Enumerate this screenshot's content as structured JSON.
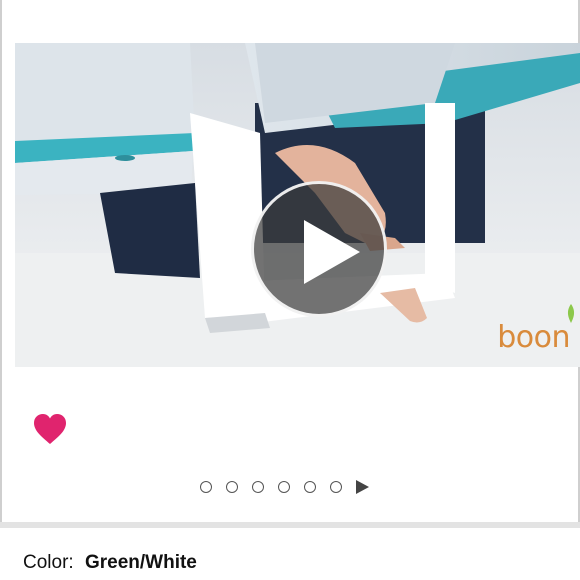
{
  "media": {
    "brand_logo_text": "boon",
    "brand_color": "#d98b3c"
  },
  "carousel": {
    "dot_count": 6,
    "active_index": 0
  },
  "favorite": {
    "state": "favorited",
    "color": "#e0246e"
  },
  "product": {
    "color_label": "Color:",
    "color_value": "Green/White"
  }
}
